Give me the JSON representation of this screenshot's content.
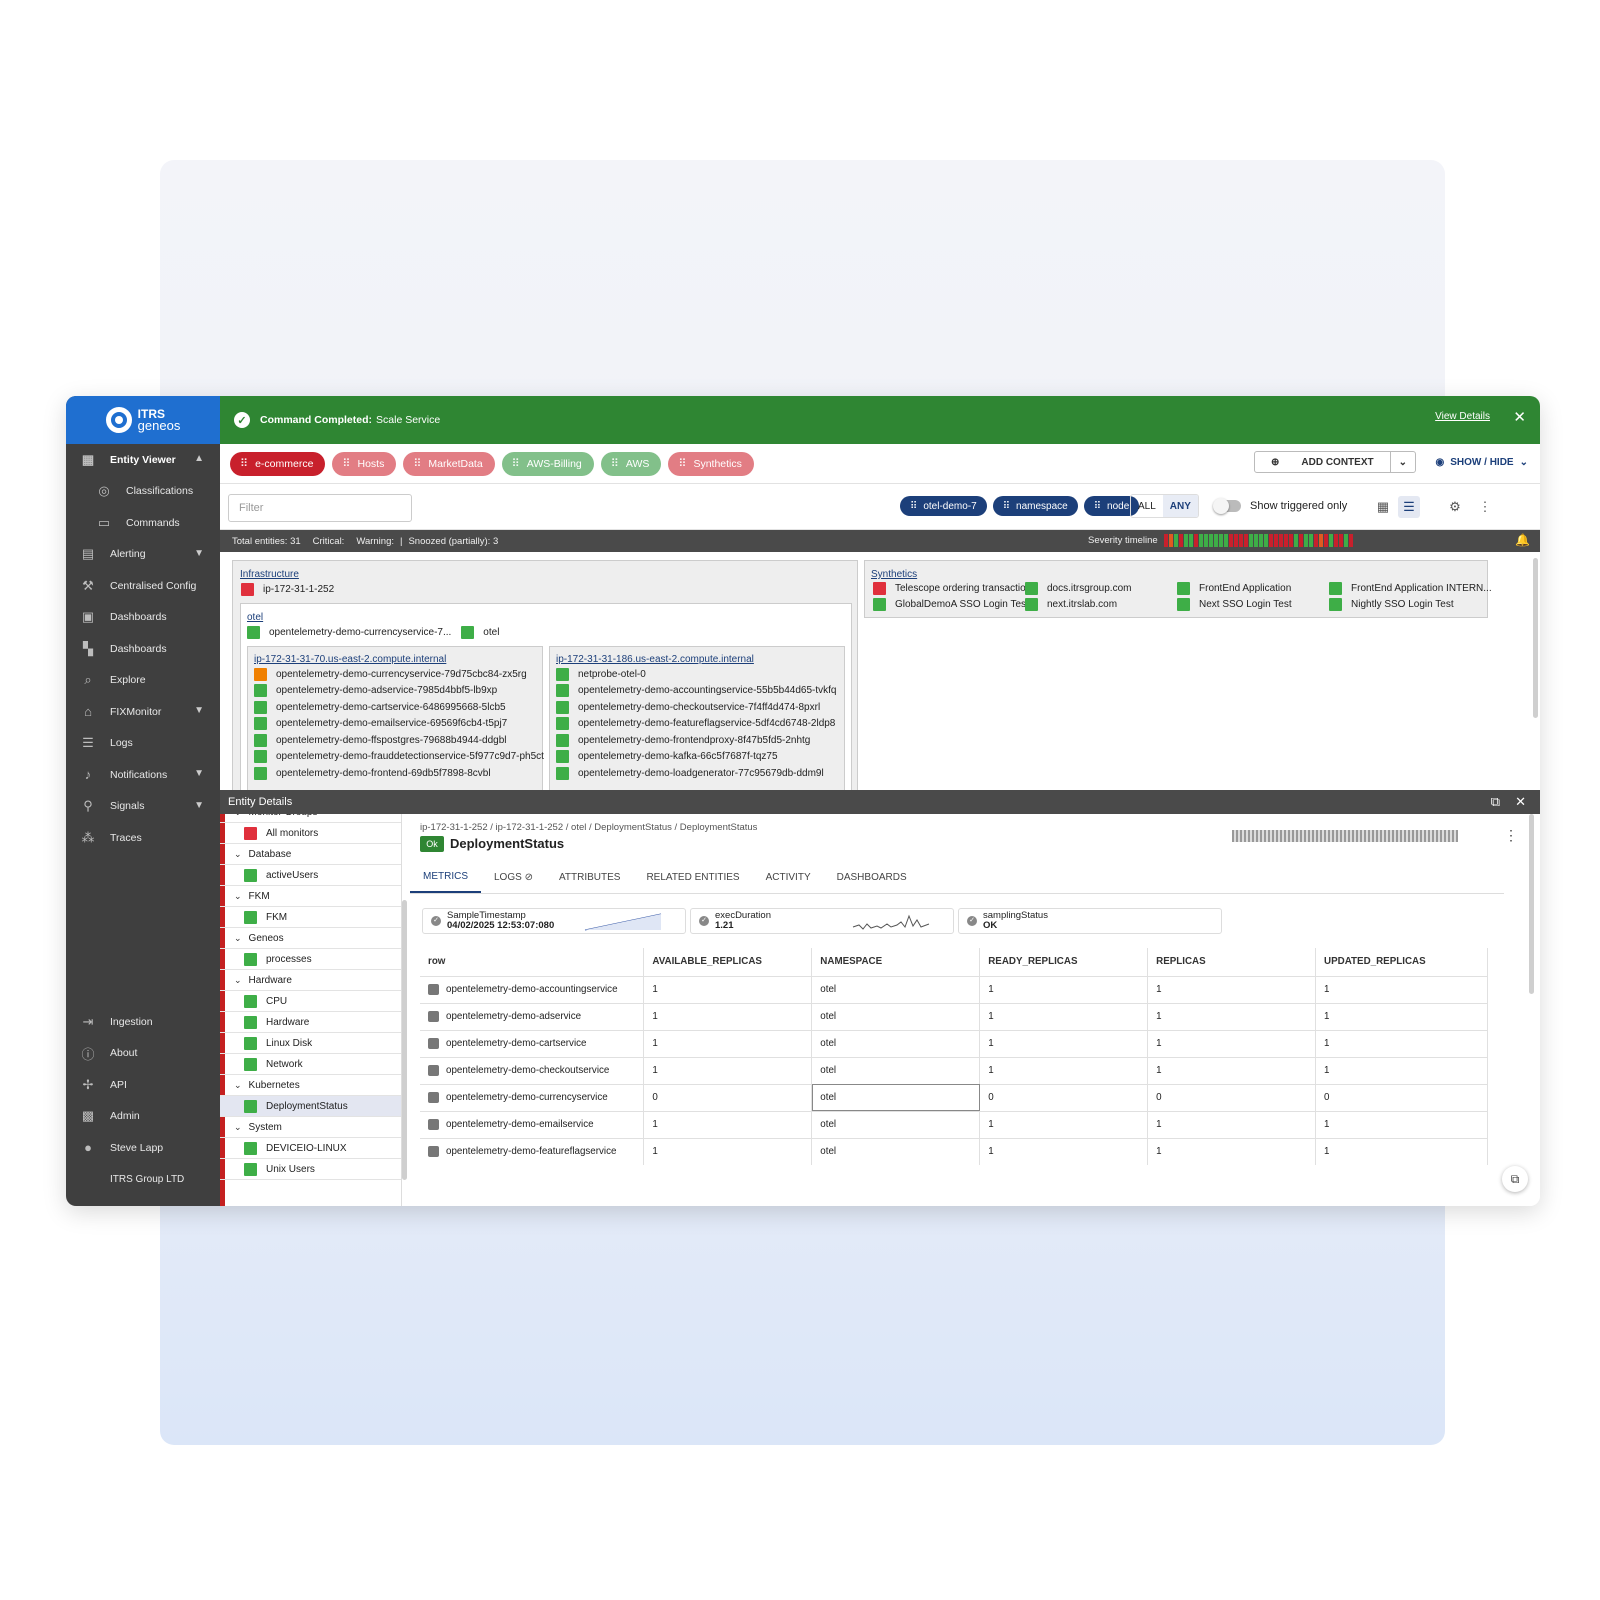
{
  "brand": {
    "line1": "ITRS",
    "line2": "geneos",
    "org": "ITRS Group LTD"
  },
  "sidebar": {
    "items": [
      {
        "label": "Entity Viewer",
        "icon": "grid-icon",
        "chevron": "▲",
        "active": true
      },
      {
        "label": "Classifications",
        "icon": "tag-icon",
        "sub": true
      },
      {
        "label": "Commands",
        "icon": "terminal-icon",
        "sub": true
      },
      {
        "label": "Alerting",
        "icon": "chart-icon",
        "chevron": "▼"
      },
      {
        "label": "Centralised Config",
        "icon": "wrench-icon"
      },
      {
        "label": "Dashboards",
        "icon": "monitor-icon"
      },
      {
        "label": "Dashboards",
        "icon": "dashboard-icon"
      },
      {
        "label": "Explore",
        "icon": "search-icon"
      },
      {
        "label": "FIXMonitor",
        "icon": "bank-icon",
        "chevron": "▼"
      },
      {
        "label": "Logs",
        "icon": "list-icon"
      },
      {
        "label": "Notifications",
        "icon": "bell-icon",
        "chevron": "▼"
      },
      {
        "label": "Signals",
        "icon": "signal-icon",
        "chevron": "▼"
      },
      {
        "label": "Traces",
        "icon": "traces-icon"
      }
    ],
    "bottom": [
      {
        "label": "Ingestion",
        "icon": "ingestion-icon"
      },
      {
        "label": "About",
        "icon": "info-icon"
      },
      {
        "label": "API",
        "icon": "api-icon"
      },
      {
        "label": "Admin",
        "icon": "admin-icon"
      },
      {
        "label": "Steve Lapp",
        "icon": "user-icon"
      }
    ]
  },
  "banner": {
    "prefix": "Command Completed:",
    "text": "Scale Service",
    "link": "View Details"
  },
  "contexts": [
    {
      "label": "e-commerce",
      "color": "#c8202c"
    },
    {
      "label": "Hosts",
      "color": "#e27d84"
    },
    {
      "label": "MarketData",
      "color": "#e27d84"
    },
    {
      "label": "AWS-Billing",
      "color": "#82c08a"
    },
    {
      "label": "AWS",
      "color": "#82c08a"
    },
    {
      "label": "Synthetics",
      "color": "#e27d84"
    }
  ],
  "toolbar": {
    "add_context": "ADD CONTEXT",
    "show_hide": "SHOW / HIDE",
    "filter_placeholder": "Filter",
    "all": "ALL",
    "any": "ANY",
    "triggered": "Show triggered only"
  },
  "tags": [
    "otel-demo-7",
    "namespace",
    "node"
  ],
  "status": {
    "total": "Total entities: 31",
    "critical": "Critical:",
    "warning": "Warning:",
    "snoozed": "Snoozed (partially): 3",
    "timeline": "Severity timeline"
  },
  "severity_colors": [
    "#c8202c",
    "#e05a20",
    "#3eae47",
    "#c8202c",
    "#3eae47",
    "#3eae47",
    "#c8202c",
    "#3eae47",
    "#3eae47",
    "#3eae47",
    "#3eae47",
    "#3eae47",
    "#3eae47",
    "#c8202c",
    "#c8202c",
    "#c8202c",
    "#c8202c",
    "#3eae47",
    "#3eae47",
    "#3eae47",
    "#3eae47",
    "#c8202c",
    "#c8202c",
    "#c8202c",
    "#c8202c",
    "#c8202c",
    "#3eae47",
    "#c8202c",
    "#3eae47",
    "#3eae47",
    "#c8202c",
    "#e05a20",
    "#c8202c",
    "#3eae47",
    "#c8202c",
    "#c8202c",
    "#3eae47",
    "#c8202c"
  ],
  "infrastructure": {
    "title": "Infrastructure",
    "host": {
      "name": "ip-172-31-1-252",
      "status": "red"
    },
    "otel_title": "otel",
    "otel_items": [
      {
        "name": "opentelemetry-demo-currencyservice-7...",
        "status": "green"
      },
      {
        "name": "otel",
        "status": "green"
      }
    ],
    "node1": {
      "title": "ip-172-31-31-70.us-east-2.compute.internal",
      "items": [
        {
          "name": "opentelemetry-demo-currencyservice-79d75cbc84-zx5rg",
          "status": "orange"
        },
        {
          "name": "opentelemetry-demo-adservice-7985d4bbf5-lb9xp",
          "status": "green"
        },
        {
          "name": "opentelemetry-demo-cartservice-6486995668-5lcb5",
          "status": "green"
        },
        {
          "name": "opentelemetry-demo-emailservice-69569f6cb4-t5pj7",
          "status": "green"
        },
        {
          "name": "opentelemetry-demo-ffspostgres-79688b4944-ddgbl",
          "status": "green"
        },
        {
          "name": "opentelemetry-demo-frauddetectionservice-5f977c9d7-ph5ct",
          "status": "green"
        },
        {
          "name": "opentelemetry-demo-frontend-69db5f7898-8cvbl",
          "status": "green"
        }
      ]
    },
    "node2": {
      "title": "ip-172-31-31-186.us-east-2.compute.internal",
      "items": [
        {
          "name": "netprobe-otel-0",
          "status": "green"
        },
        {
          "name": "opentelemetry-demo-accountingservice-55b5b44d65-tvkfq",
          "status": "green"
        },
        {
          "name": "opentelemetry-demo-checkoutservice-7f4ff4d474-8pxrl",
          "status": "green"
        },
        {
          "name": "opentelemetry-demo-featureflagservice-5df4cd6748-2ldp8",
          "status": "green"
        },
        {
          "name": "opentelemetry-demo-frontendproxy-8f47b5fd5-2nhtg",
          "status": "green"
        },
        {
          "name": "opentelemetry-demo-kafka-66c5f7687f-tqz75",
          "status": "green"
        },
        {
          "name": "opentelemetry-demo-loadgenerator-77c95679db-ddm9l",
          "status": "green"
        }
      ]
    }
  },
  "synthetics": {
    "title": "Synthetics",
    "items": [
      {
        "name": "Telescope ordering transaction",
        "status": "red"
      },
      {
        "name": "docs.itrsgroup.com",
        "status": "green"
      },
      {
        "name": "FrontEnd Application",
        "status": "green"
      },
      {
        "name": "FrontEnd Application INTERN...",
        "status": "green"
      },
      {
        "name": "GlobalDemoA SSO Login Test",
        "status": "green"
      },
      {
        "name": "next.itrslab.com",
        "status": "green"
      },
      {
        "name": "Next SSO Login Test",
        "status": "green"
      },
      {
        "name": "Nightly SSO Login Test",
        "status": "green"
      }
    ]
  },
  "details": {
    "header": "Entity Details",
    "tree": [
      {
        "label": "Monitor Groups",
        "type": "group"
      },
      {
        "label": "All monitors",
        "type": "leaf",
        "status": "red"
      },
      {
        "label": "Database",
        "type": "group"
      },
      {
        "label": "activeUsers",
        "type": "leaf",
        "status": "green"
      },
      {
        "label": "FKM",
        "type": "group"
      },
      {
        "label": "FKM",
        "type": "leaf",
        "status": "green"
      },
      {
        "label": "Geneos",
        "type": "group"
      },
      {
        "label": "processes",
        "type": "leaf",
        "status": "green"
      },
      {
        "label": "Hardware",
        "type": "group"
      },
      {
        "label": "CPU",
        "type": "leaf",
        "status": "green"
      },
      {
        "label": "Hardware",
        "type": "leaf",
        "status": "green"
      },
      {
        "label": "Linux Disk",
        "type": "leaf",
        "status": "green"
      },
      {
        "label": "Network",
        "type": "leaf",
        "status": "green"
      },
      {
        "label": "Kubernetes",
        "type": "group"
      },
      {
        "label": "DeploymentStatus",
        "type": "leaf",
        "status": "green",
        "selected": true
      },
      {
        "label": "System",
        "type": "group"
      },
      {
        "label": "DEVICEIO-LINUX",
        "type": "leaf",
        "status": "green"
      },
      {
        "label": "Unix Users",
        "type": "leaf",
        "status": "green"
      }
    ],
    "breadcrumb": "ip-172-31-1-252  /  ip-172-31-1-252  /  otel  /  DeploymentStatus  /  DeploymentStatus",
    "badge": "Ok",
    "title": "DeploymentStatus",
    "tabs": [
      "METRICS",
      "LOGS ⊘",
      "ATTRIBUTES",
      "RELATED ENTITIES",
      "ACTIVITY",
      "DASHBOARDS"
    ],
    "metrics": [
      {
        "name": "SampleTimestamp",
        "value": "04/02/2025 12:53:07:080"
      },
      {
        "name": "execDuration",
        "value": "1.21"
      },
      {
        "name": "samplingStatus",
        "value": "OK"
      }
    ],
    "columns": [
      "row",
      "AVAILABLE_REPLICAS",
      "NAMESPACE",
      "READY_REPLICAS",
      "REPLICAS",
      "UPDATED_REPLICAS"
    ],
    "rows": [
      [
        "opentelemetry-demo-accountingservice",
        "1",
        "otel",
        "1",
        "1",
        "1"
      ],
      [
        "opentelemetry-demo-adservice",
        "1",
        "otel",
        "1",
        "1",
        "1"
      ],
      [
        "opentelemetry-demo-cartservice",
        "1",
        "otel",
        "1",
        "1",
        "1"
      ],
      [
        "opentelemetry-demo-checkoutservice",
        "1",
        "otel",
        "1",
        "1",
        "1"
      ],
      [
        "opentelemetry-demo-currencyservice",
        "0",
        "otel",
        "0",
        "0",
        "0"
      ],
      [
        "opentelemetry-demo-emailservice",
        "1",
        "otel",
        "1",
        "1",
        "1"
      ],
      [
        "opentelemetry-demo-featureflagservice",
        "1",
        "otel",
        "1",
        "1",
        "1"
      ]
    ]
  }
}
